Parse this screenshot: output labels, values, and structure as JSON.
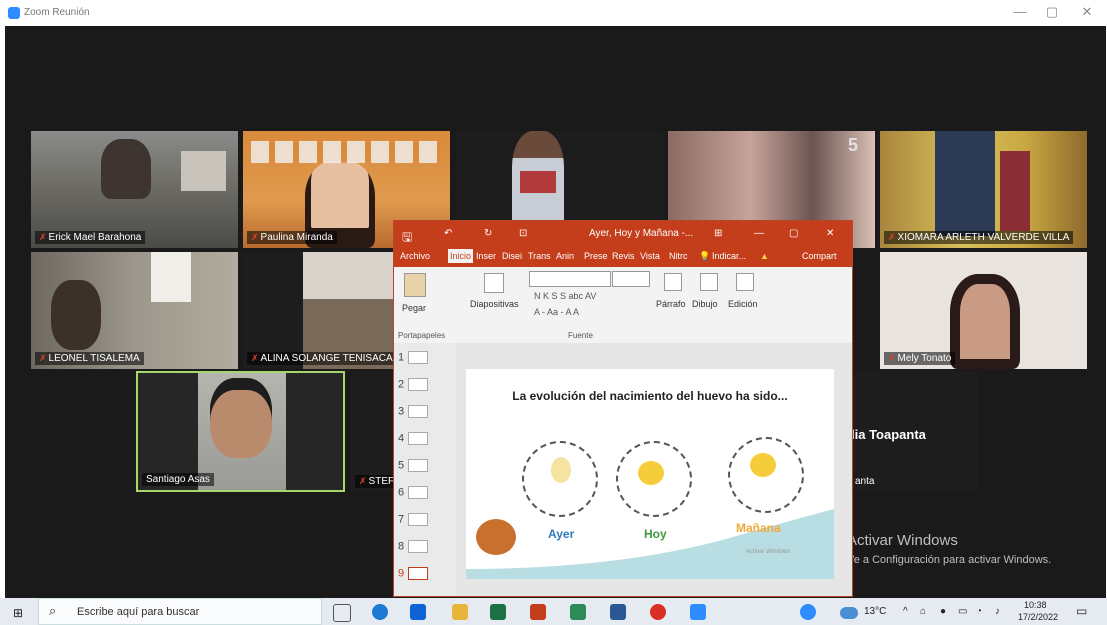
{
  "window": {
    "title": "Zoom Reunión",
    "min": "—",
    "max": "▢",
    "close": "✕"
  },
  "participants": [
    {
      "name": "Erick Mael Barahona"
    },
    {
      "name": "Paulina Miranda"
    },
    {
      "name": "XIOMARA ARLETH VALVERDE VILLA"
    },
    {
      "name": "LEONEL  TISALEMA"
    },
    {
      "name": "ALINA SOLANGE TENISACA V"
    },
    {
      "name": "Mely Tonato"
    },
    {
      "name": "Santiago Asas"
    },
    {
      "name": "STEFA"
    },
    {
      "name": "anta"
    }
  ],
  "big_name": "lia Toapanta",
  "activate": {
    "line1": "Activar Windows",
    "line2": "Ve a Configuración para activar Windows."
  },
  "ppt": {
    "title": "Ayer, Hoy y Mañana -...",
    "tabs": [
      "Archivo",
      "Inicio",
      "Inser",
      "Disei",
      "Trans",
      "Anin",
      "Prese",
      "Revis",
      "Vista",
      "Nitrc"
    ],
    "indicator": "Indicar...",
    "share": "Compart",
    "ribbon": {
      "paste": "Pegar",
      "slides": "Diapositivas",
      "font_buttons": "N  K  S  S  abc  AV",
      "font_row2": "A  -  Aa  -   A  A",
      "paragraph": "Párrafo",
      "drawing": "Dibujo",
      "editing": "Edición",
      "group_clipboard": "Portapapeles",
      "group_font": "Fuente"
    },
    "thumbnails": [
      "1",
      "2",
      "3",
      "4",
      "5",
      "6",
      "7",
      "8",
      "9"
    ],
    "slide": {
      "heading": "La evolución del nacimiento del huevo ha sido...",
      "labels": [
        "Ayer",
        "Hoy",
        "Mañana"
      ],
      "watermark": "Activar Windows"
    }
  },
  "taskbar": {
    "search_placeholder": "Escribe aquí para buscar",
    "weather": "13°C",
    "time": "10:38",
    "date": "17/2/2022"
  }
}
